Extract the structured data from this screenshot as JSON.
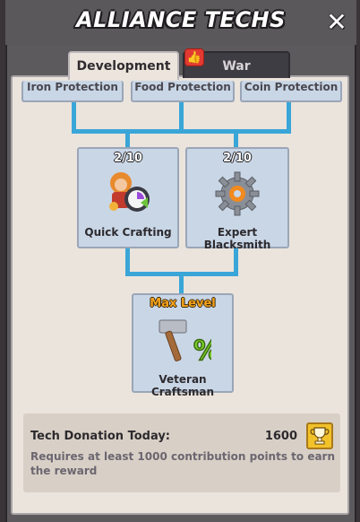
{
  "header": {
    "title": "ALLIANCE TECHS",
    "close_icon": "close-icon"
  },
  "tabs": [
    {
      "label": "Development",
      "active": true
    },
    {
      "label": "War",
      "active": false,
      "badge_icon": "thumbs-up-icon"
    }
  ],
  "tree": {
    "top_row": [
      {
        "label": "Iron Protection"
      },
      {
        "label": "Food Protection"
      },
      {
        "label": "Coin Protection"
      }
    ],
    "middle_row": [
      {
        "label": "Quick Crafting",
        "count": "2/10",
        "icon": "crafting-character-icon"
      },
      {
        "label": "Expert Blacksmith",
        "count": "2/10",
        "icon": "gear-icon"
      }
    ],
    "bottom_row": [
      {
        "label": "Veteran Craftsman",
        "status": "Max Level",
        "icon": "hammer-percent-icon"
      }
    ]
  },
  "donation": {
    "title": "Tech Donation Today:",
    "value": "1600",
    "description": "Requires at least 1000 contribution points to earn the reward",
    "trophy_icon": "trophy-icon"
  },
  "colors": {
    "connector": "#3aa6d8",
    "node_bg": "#c9d6e6",
    "panel_bg": "#ebe4dc",
    "max_level": "#f5a21a",
    "trophy_bg": "#f2c22a"
  }
}
